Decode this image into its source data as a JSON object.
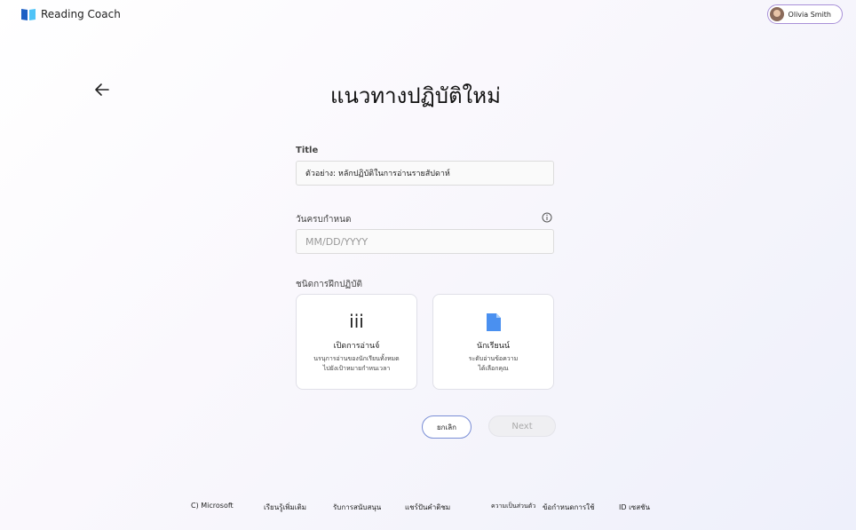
{
  "header": {
    "app_name": "Reading Coach",
    "user_name": "Olivia Smith"
  },
  "page": {
    "title": "แนวทางปฏิบัติใหม่"
  },
  "form": {
    "title_label": "Title",
    "title_value": "ตัวอย่าง: หลักปฏิบัติในการอ่านรายสัปดาห์",
    "due_label": "วันครบกำหนด",
    "due_placeholder": "MM/DD/YYYY",
    "type_label": "ชนิดการฝึกปฏิบัติ"
  },
  "cards": [
    {
      "icon": "iii",
      "title": "เปิดการอ่านจ์",
      "desc_1": "นรนุการอ่านของนักเรียนทั้งหมด",
      "desc_2": "ไปยังเป้าหมายกำหนเวลา"
    },
    {
      "title": "นักเรียนน์",
      "desc_1": "ระดับอ่านข้อความ",
      "desc_2": "ได้เลือกคุณ"
    }
  ],
  "buttons": {
    "cancel": "ยกเลิก",
    "next": "Next"
  },
  "footer": {
    "copyright": "C) Microsoft",
    "links": [
      "เรียนรู้เพิ่มเติม",
      "รับการสนับสนุน",
      "แชร์ปันคำติชม",
      "ความเป็นส่วนตัว",
      "ข้อกำหนดการใช้",
      "ID เซสชัน"
    ]
  },
  "colors": {
    "accent": "#7a8ed6",
    "logo_dark": "#1c5fc4",
    "logo_light": "#4fc3f7"
  }
}
